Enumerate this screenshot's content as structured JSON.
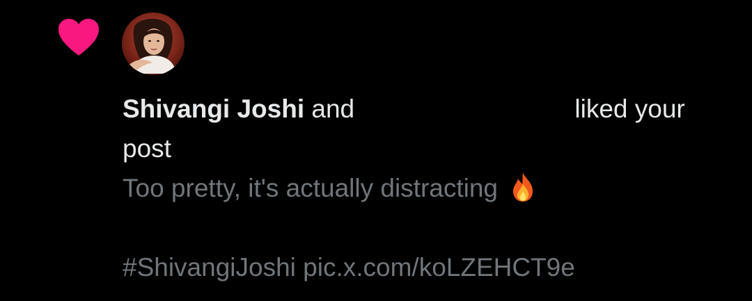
{
  "notification": {
    "type_icon": "heart-icon",
    "accent_color": "#f91880",
    "avatar": "avatar",
    "actor_name": "Shivangi Joshi",
    "connector": "and",
    "action_text": "liked your post",
    "post": {
      "line1": "Too pretty, it's actually distracting",
      "emoji_icon": "fire-icon",
      "hashtag": "#ShivangiJoshi",
      "link": "pic.x.com/koLZEHCT9e"
    }
  },
  "colors": {
    "background": "#000000",
    "primary_text": "#e7e9ea",
    "secondary_text": "#71767b",
    "heart": "#f91880"
  }
}
